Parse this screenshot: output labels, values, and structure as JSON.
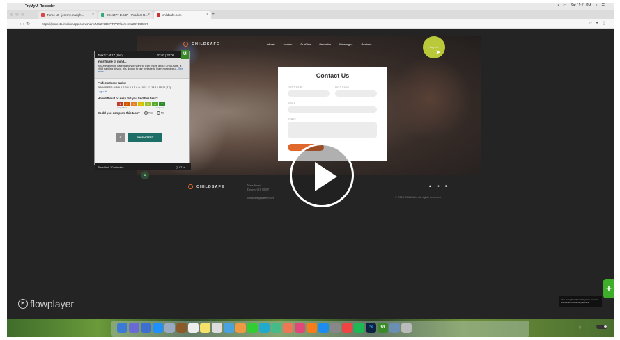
{
  "menubar": {
    "app": "TryMyUI Recorder",
    "clock": "Sat 11:11 PM"
  },
  "browser": {
    "tabs": [
      {
        "label": "Turbo UI - jeremy.marigh...",
        "color": "#d44"
      },
      {
        "label": "0014377 D.58P - Product R...",
        "color": "#3a7"
      },
      {
        "label": "childsafe.com",
        "color": "#c33"
      }
    ],
    "url": "https://projects.invisionapp.com/share/NW2A3D0YF7R#/screens/287190377"
  },
  "site": {
    "brand": "CHILDSAFE",
    "nav": [
      "About",
      "Locate",
      "Profiles",
      "Calendar",
      "Messages",
      "Contact"
    ],
    "logout": "Log out"
  },
  "task": {
    "header": "Task 17 of 17 (Skip)",
    "timer": "03:07 | 20:00",
    "badge": "UI",
    "scenario_title": "Your frame of mind...",
    "scenario_text": "You are a single parent and you want to learn more about CHILDsafe, a child tracking device. You log on to our website to learn more abou...",
    "see_more": "See more",
    "perform_title": "Perform these tasks:",
    "progress": "PROGRESS: 4 5 6 1 2 3 4 5 6 7 8 9 10 11 12 13 14 15 16 (17)",
    "logout_link": "Log out",
    "difficulty_q": "How difficult or easy did you find this task?",
    "ratings": [
      "1",
      "2",
      "3",
      "4",
      "5",
      "6",
      "7"
    ],
    "rating_colors": [
      "#c0392b",
      "#d35400",
      "#e67e22",
      "#d4c200",
      "#9ac12a",
      "#55a92c",
      "#2e8b2e"
    ],
    "rate_low": "Very difficult",
    "rate_high": "Very easy",
    "complete_q": "Could you complete this task?",
    "yes": "Yes",
    "no": "No",
    "back": "<",
    "finish": "FINISH TEST",
    "time_limit": "Time limit 20 minutes",
    "quit": "QUIT"
  },
  "contact": {
    "title": "Contact Us",
    "first": "FIRST NAME",
    "last": "LAST NAME",
    "email": "EMAIL",
    "query": "QUERY"
  },
  "footer": {
    "brand": "CHILDSAFE",
    "address": "Main Street,\nDenver, CO, 80007",
    "email": "childsafe@safety.com",
    "copyright": "© 2014 ChildSafe. All rights reserved.",
    "icons": [
      "facebook-icon",
      "twitter-icon",
      "instagram-icon"
    ]
  },
  "player": {
    "brand": "flowplayer",
    "tooltip": "Stop or replay video at any time for more precise and accurate playback"
  }
}
